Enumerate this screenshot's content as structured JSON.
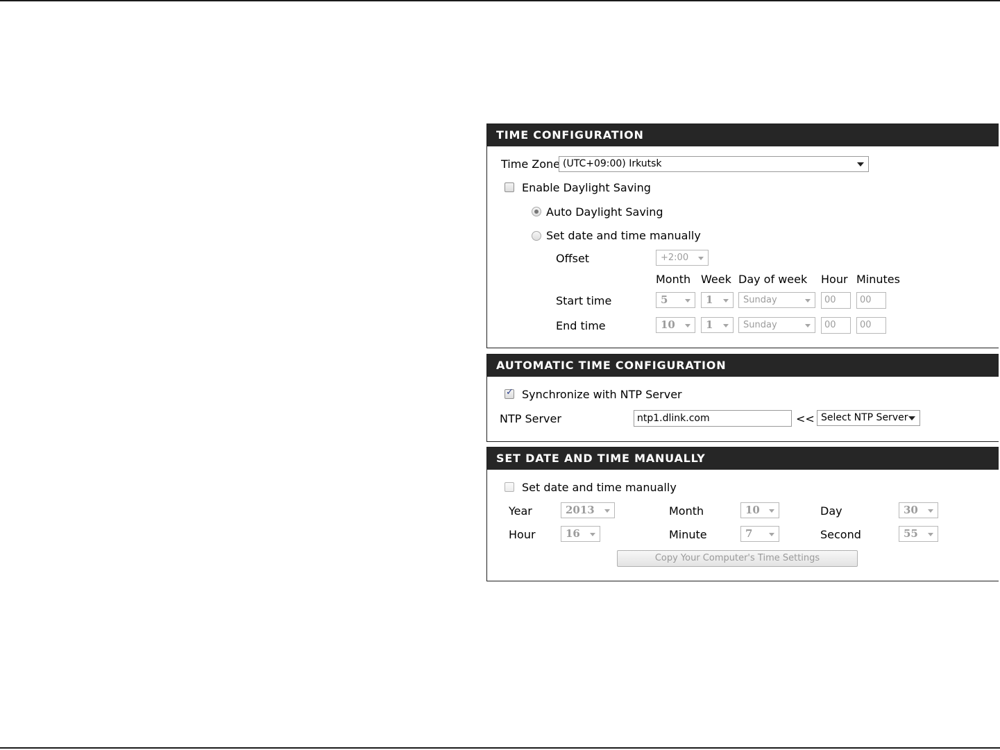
{
  "time_config": {
    "header": "TIME CONFIGURATION",
    "time_zone_label": "Time Zone",
    "time_zone_value": "(UTC+09:00) Irkutsk",
    "enable_dst_label": "Enable Daylight Saving",
    "enable_dst_checked": false,
    "auto_dst_label": "Auto Daylight Saving",
    "manual_dst_label": "Set date and time manually",
    "offset_label": "Offset",
    "offset_value": "+2:00",
    "columns": {
      "month": "Month",
      "week": "Week",
      "day_of_week": "Day of week",
      "hour": "Hour",
      "minutes": "Minutes"
    },
    "start": {
      "label": "Start time",
      "month": "5",
      "week": "1",
      "day": "Sunday",
      "hour": "00",
      "minutes": "00"
    },
    "end": {
      "label": "End time",
      "month": "10",
      "week": "1",
      "day": "Sunday",
      "hour": "00",
      "minutes": "00"
    }
  },
  "auto_time": {
    "header": "AUTOMATIC TIME CONFIGURATION",
    "sync_label": "Synchronize with NTP Server",
    "sync_checked": true,
    "ntp_label": "NTP Server",
    "ntp_value": "ntp1.dlink.com",
    "arrows": "<<",
    "select_ntp": "Select NTP Server"
  },
  "manual_time": {
    "header": "SET DATE AND TIME MANUALLY",
    "manual_label": "Set date and time manually",
    "manual_checked": false,
    "year_label": "Year",
    "year_value": "2013",
    "month_label": "Month",
    "month_value": "10",
    "day_label": "Day",
    "day_value": "30",
    "hour_label": "Hour",
    "hour_value": "16",
    "minute_label": "Minute",
    "minute_value": "7",
    "second_label": "Second",
    "second_value": "55",
    "copy_button": "Copy Your Computer's Time Settings"
  }
}
